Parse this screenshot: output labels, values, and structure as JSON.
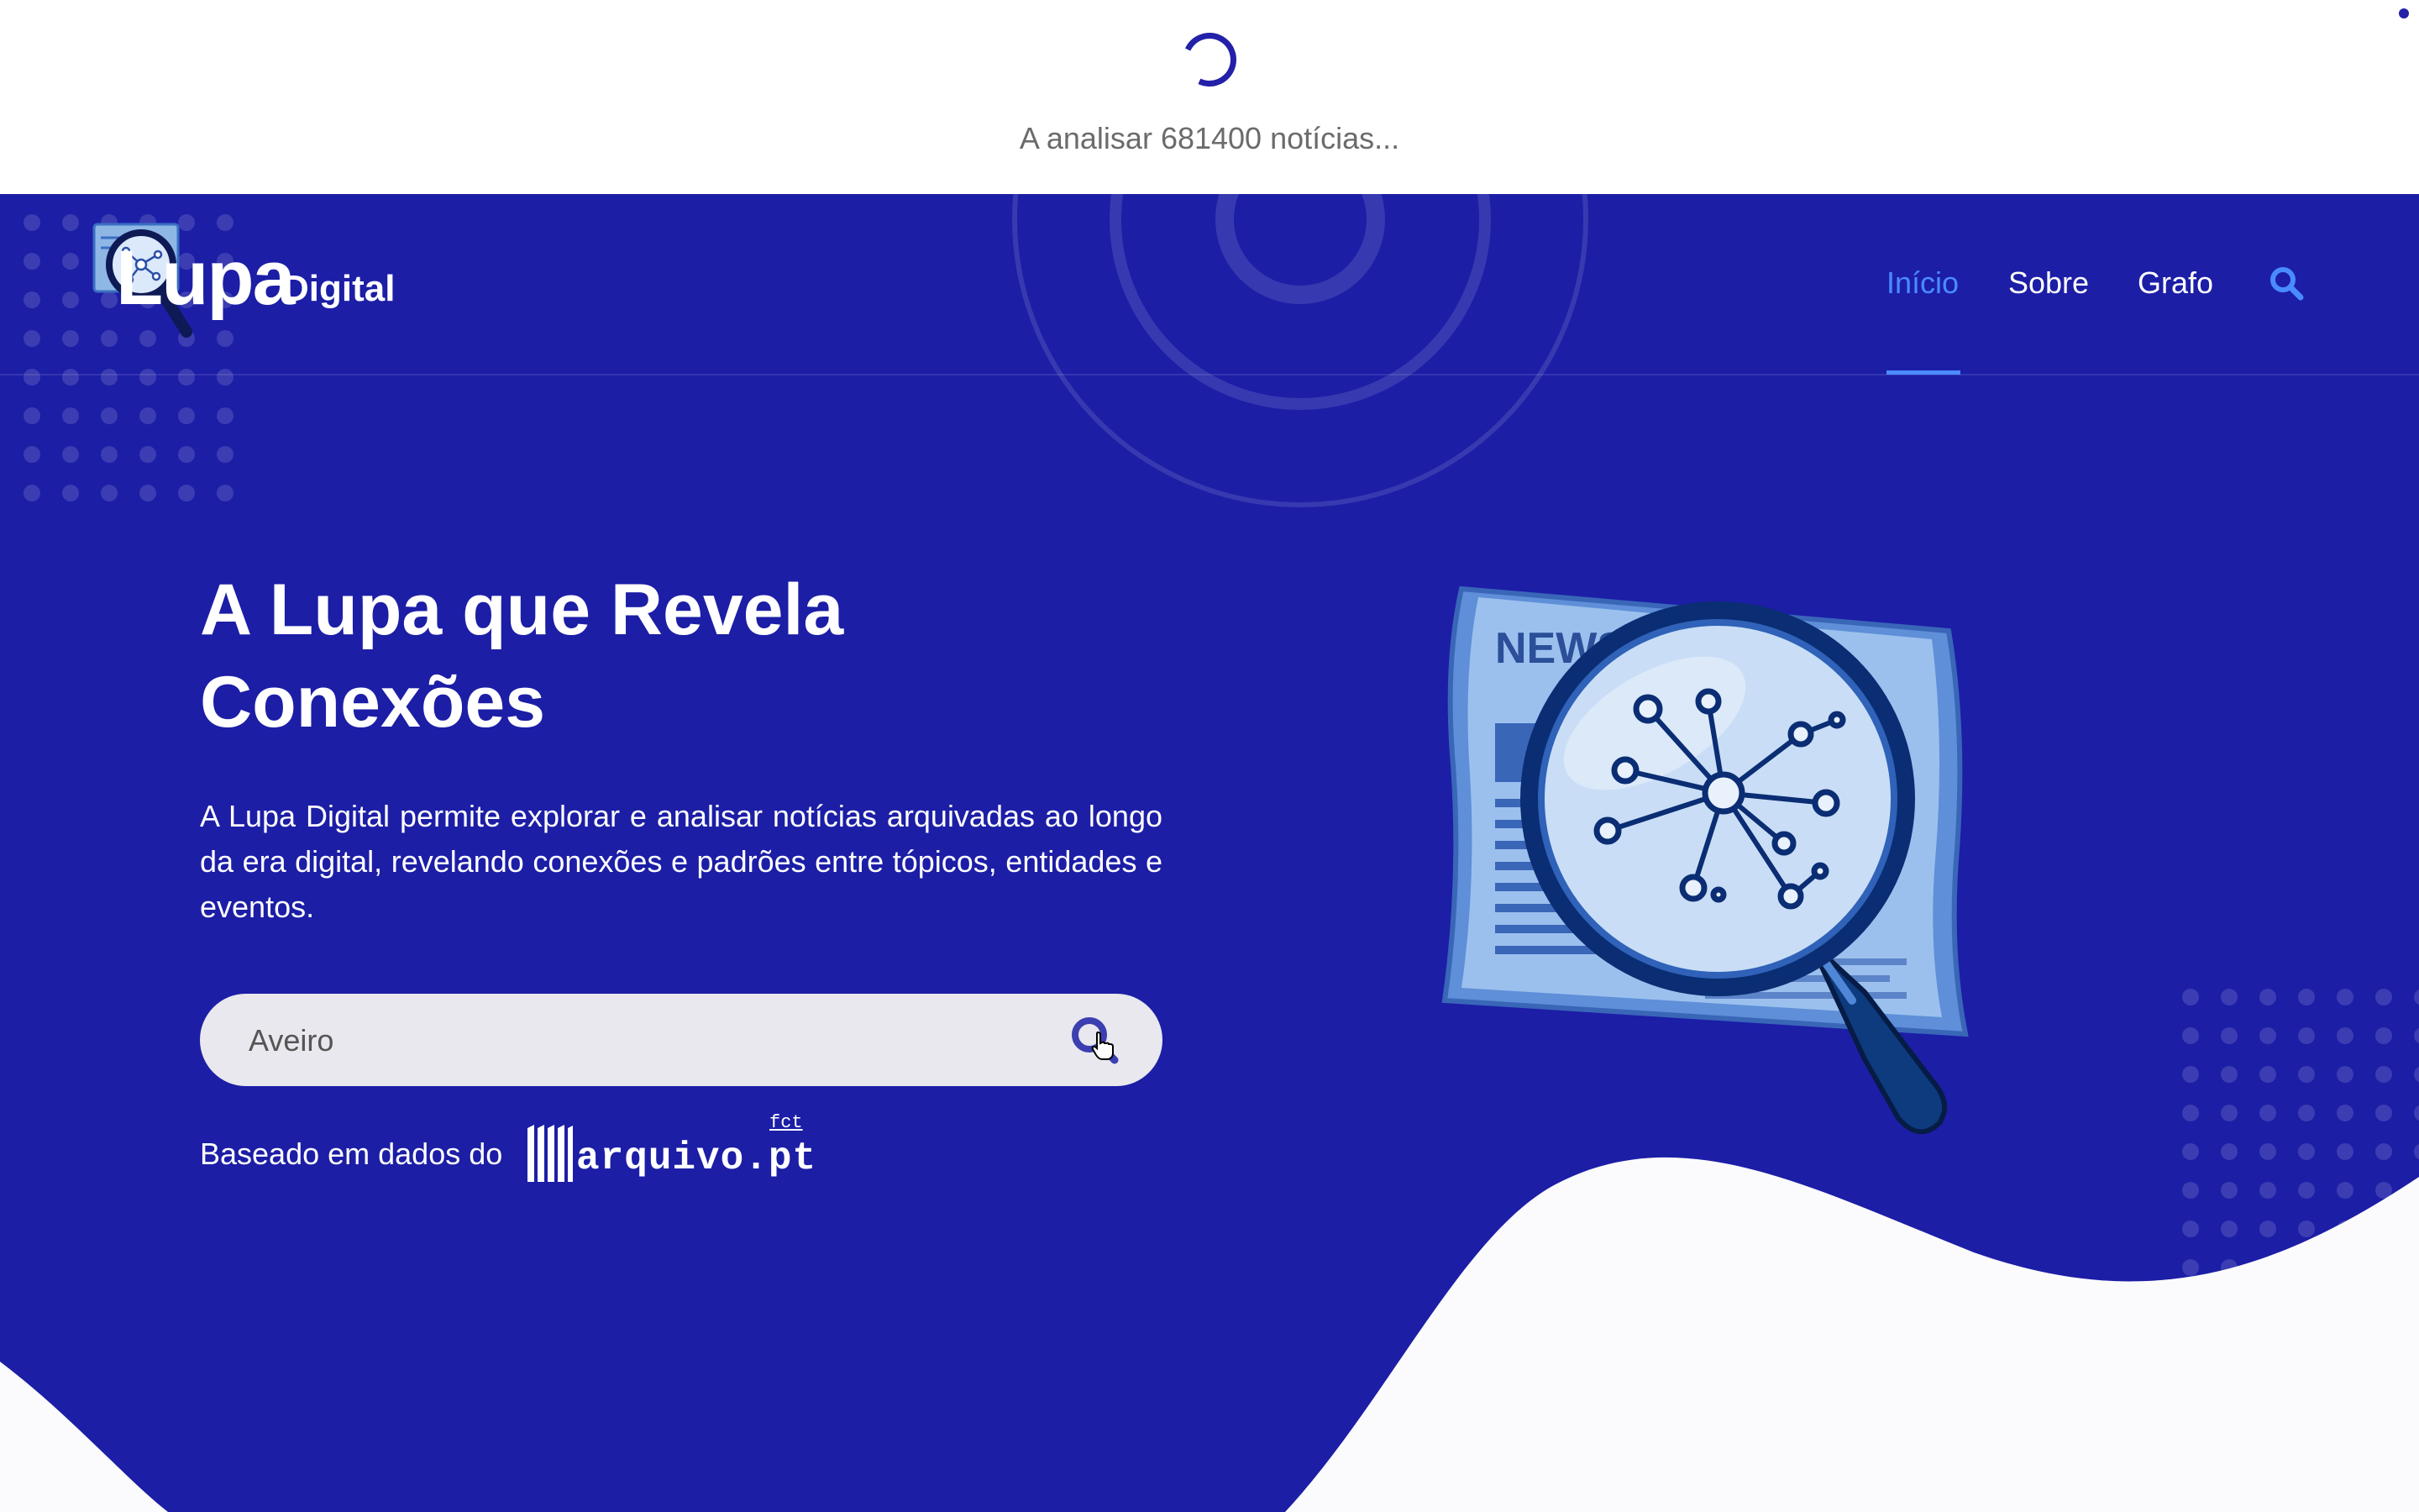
{
  "loading": {
    "text": "A analisar 681400 notícias..."
  },
  "brand": {
    "name": "Lupa",
    "suffix": "Digital"
  },
  "nav": {
    "items": [
      {
        "label": "Início",
        "active": true
      },
      {
        "label": "Sobre",
        "active": false
      },
      {
        "label": "Grafo",
        "active": false
      }
    ],
    "search_icon": "search-icon"
  },
  "hero": {
    "title_line1": "A Lupa que Revela",
    "title_line2": "Conexões",
    "description": "A Lupa Digital permite explorar e analisar notícias arquivadas ao longo da era digital, revelando conexões e padrões entre tópicos, entidades e eventos.",
    "search": {
      "value": "Aveiro",
      "button_icon": "search-icon"
    },
    "source_label": "Baseado em dados do",
    "source_logo": {
      "text": "arquivo.pt",
      "superscript": "fct"
    },
    "illustration_text": "NEWS"
  },
  "colors": {
    "hero_background": "#1c1ea6",
    "accent": "#4a8bff",
    "spinner": "#2321a8",
    "search_field": "#e8e8ee"
  }
}
